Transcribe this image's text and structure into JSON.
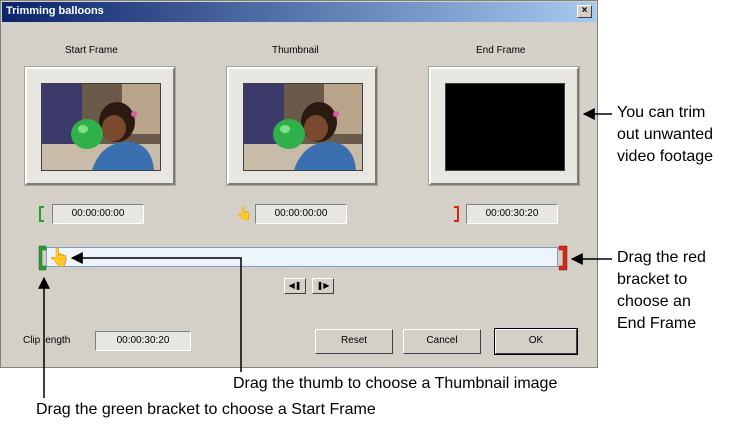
{
  "dialog": {
    "title": "Trimming balloons",
    "close_glyph": "×",
    "start_frame_label": "Start Frame",
    "thumbnail_label": "Thumbnail",
    "end_frame_label": "End Frame",
    "start_time": "00:00:00:00",
    "thumbnail_time": "00:00:00:00",
    "end_time": "00:00:30:20",
    "clip_length_label": "Clip length",
    "clip_length_value": "00:00:30:20",
    "reset_label": "Reset",
    "cancel_label": "Cancel",
    "ok_label": "OK",
    "step_back_glyph": "◀❚",
    "step_forward_glyph": "❚▶",
    "start_bracket_color": "#2e9b2e",
    "end_bracket_color": "#d42a1a",
    "thumb_position": 0
  },
  "annotations": {
    "trim": [
      "You can trim",
      "out unwanted",
      "video footage"
    ],
    "red_bracket": [
      "Drag the red",
      "bracket to",
      "choose an",
      "End Frame"
    ],
    "thumb": "Drag the thumb to choose a Thumbnail image",
    "green_bracket": "Drag the green bracket to choose a Start Frame"
  }
}
